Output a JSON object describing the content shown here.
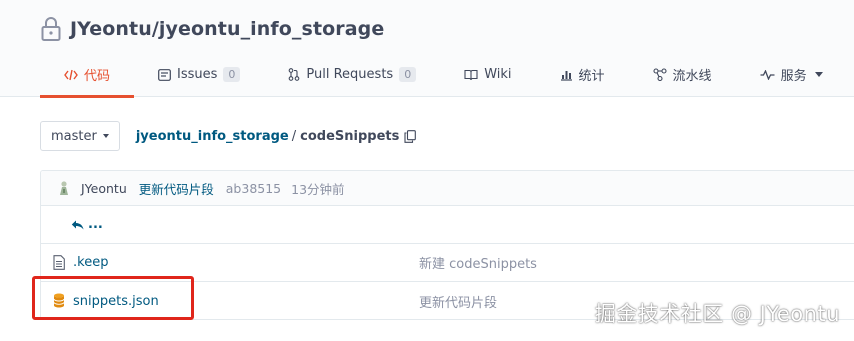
{
  "repo": {
    "title": "JYeontu/jyeontu_info_storage"
  },
  "tabs": [
    {
      "label": "代码",
      "icon": "code-icon",
      "active": true,
      "count": null
    },
    {
      "label": "Issues",
      "icon": "issues-icon",
      "active": false,
      "count": "0"
    },
    {
      "label": "Pull Requests",
      "icon": "pull-request-icon",
      "active": false,
      "count": "0"
    },
    {
      "label": "Wiki",
      "icon": "wiki-icon",
      "active": false,
      "count": null
    },
    {
      "label": "统计",
      "icon": "stats-icon",
      "active": false,
      "count": null
    },
    {
      "label": "流水线",
      "icon": "pipeline-icon",
      "active": false,
      "count": null
    },
    {
      "label": "服务",
      "icon": "service-icon",
      "active": false,
      "count": null
    }
  ],
  "branch": {
    "label": "master"
  },
  "breadcrumb": {
    "root": "jyeontu_info_storage",
    "separator": "/",
    "current": "codeSnippets"
  },
  "commit": {
    "author": "JYeontu",
    "message": "更新代码片段",
    "sha": "ab38515",
    "time": "13分钟前"
  },
  "back": {
    "label": "..."
  },
  "files": [
    {
      "name": ".keep",
      "icon": "file-icon",
      "commit": "新建 codeSnippets"
    },
    {
      "name": "snippets.json",
      "icon": "database-icon",
      "commit": "更新代码片段"
    }
  ],
  "watermark": "掘金技术社区 @ JYeontu",
  "colors": {
    "accent": "#e6502f",
    "link": "#005980",
    "highlight": "#e0261b"
  }
}
